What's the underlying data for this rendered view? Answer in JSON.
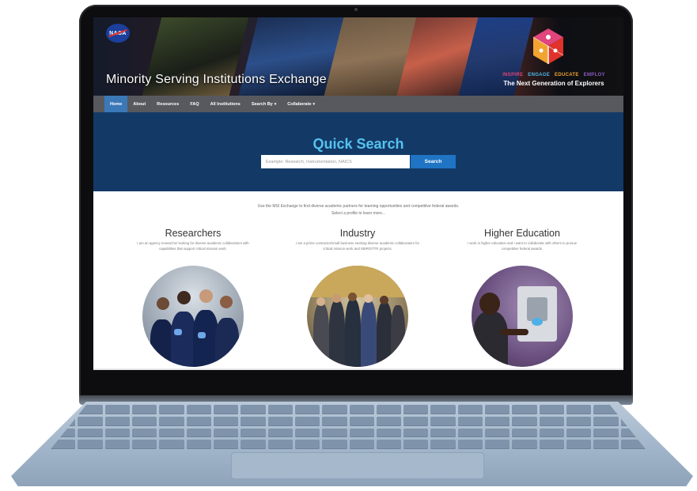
{
  "site": {
    "title": "Minority Serving Institutions Exchange",
    "agency_logo": "NASA",
    "tagline_words": [
      {
        "text": "INSPIRE",
        "color": "#e0457b"
      },
      {
        "text": "ENGAGE",
        "color": "#4fb5e6"
      },
      {
        "text": "EDUCATE",
        "color": "#f2a431"
      },
      {
        "text": "EMPLOY",
        "color": "#8d5cc4"
      }
    ],
    "tagline": "The Next Generation of Explorers"
  },
  "nav": {
    "items": [
      {
        "label": "Home",
        "active": true,
        "dropdown": false
      },
      {
        "label": "About",
        "active": false,
        "dropdown": false
      },
      {
        "label": "Resources",
        "active": false,
        "dropdown": false
      },
      {
        "label": "FAQ",
        "active": false,
        "dropdown": false
      },
      {
        "label": "All Institutions",
        "active": false,
        "dropdown": false
      },
      {
        "label": "Search By",
        "active": false,
        "dropdown": true
      },
      {
        "label": "Collaborate",
        "active": false,
        "dropdown": true
      }
    ]
  },
  "quick_search": {
    "title": "Quick Search",
    "placeholder": "Example: Research, Instrumentation, NAICS",
    "button_label": "Search"
  },
  "intro": {
    "line1": "Use the MSI Exchange to find diverse academic partners for teaming opportunities and competitive federal awards.",
    "line2": "Select a profile to learn more..."
  },
  "profiles": [
    {
      "title": "Researchers",
      "description": "I am an agency researcher looking for diverse academic collaborators with capabilities that support critical mission work."
    },
    {
      "title": "Industry",
      "description": "I am a prime contractor/small business seeking diverse academic collaborators for critical mission work and SBIR/STTR projects."
    },
    {
      "title": "Higher Education",
      "description": "I work in higher education and I want to collaborate with others to pursue competitive federal awards."
    }
  ],
  "colors": {
    "nav_bg": "#57595e",
    "nav_active": "#3b78b8",
    "search_band": "#133a67",
    "search_title": "#56c2ef",
    "search_button": "#1f74c4"
  }
}
